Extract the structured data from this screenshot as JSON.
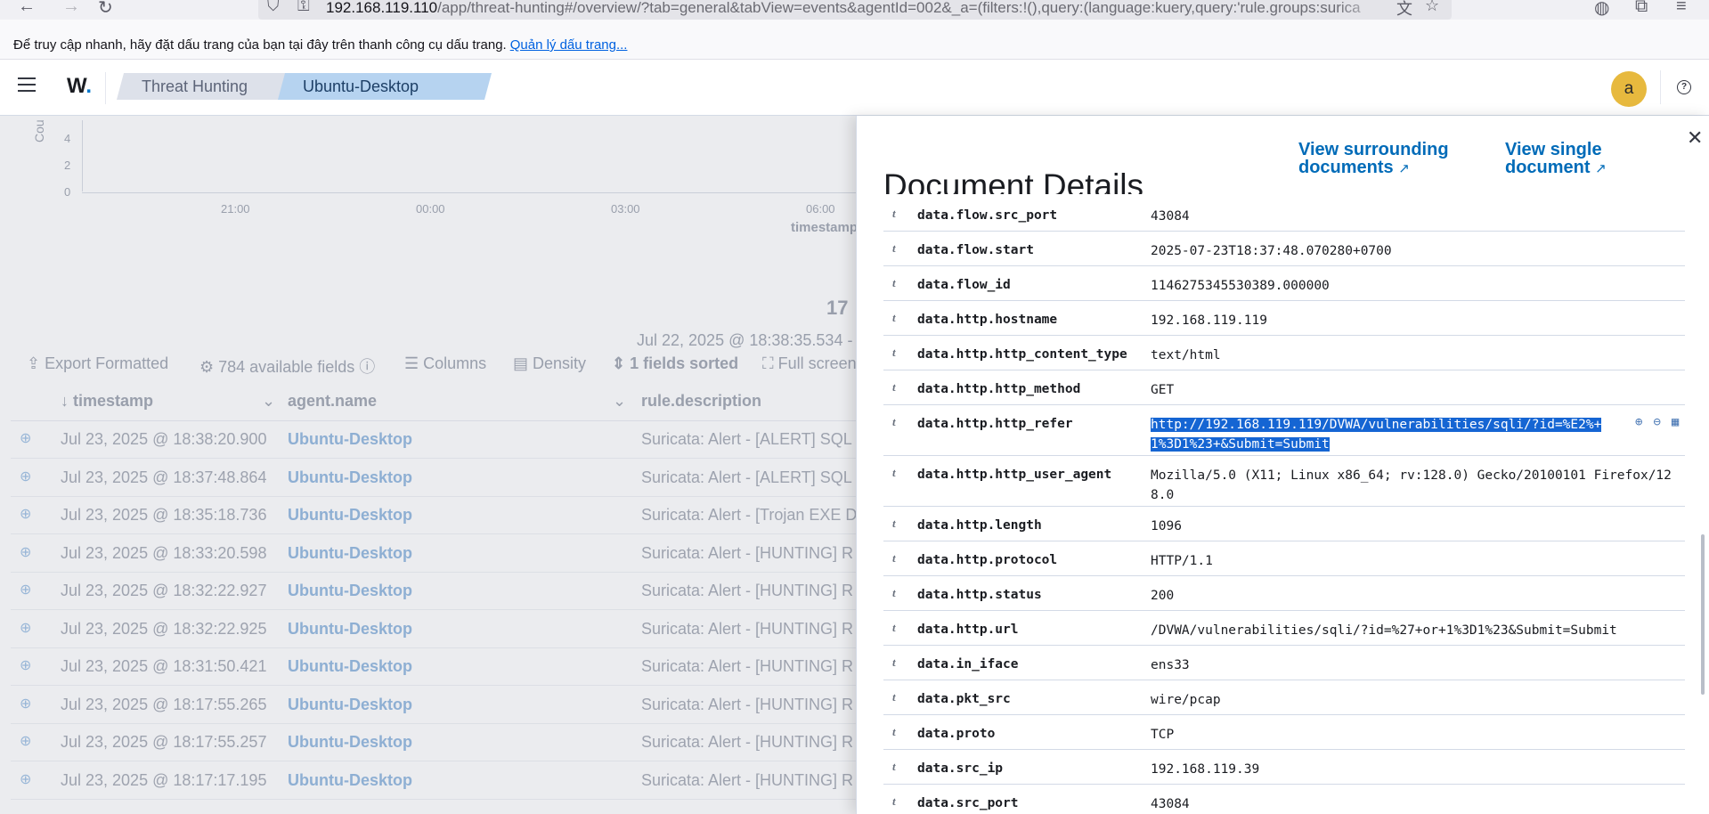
{
  "browser": {
    "url_host": "192.168.119.110",
    "url_rest": "/app/threat-hunting#/overview/?tab=general&tabView=events&agentId=002&_a=(filters:!(),query:(language:kuery,query:'rule.groups:surica",
    "bookmark_prompt": "Để truy cập nhanh, hãy đặt dấu trang của bạn tại đây trên thanh công cụ dấu trang.",
    "bookmark_manage": "Quản lý dấu trang..."
  },
  "header": {
    "logo": "W",
    "breadcrumbs": [
      "Threat Hunting",
      "Ubuntu-Desktop"
    ],
    "avatar": "a",
    "help": "?"
  },
  "chart": {
    "ylabel": "Cou",
    "yticks": [
      "4",
      "2",
      "0"
    ],
    "xticks": [
      "21:00",
      "00:00",
      "03:00",
      "06:00"
    ],
    "xlabel": "timestamp"
  },
  "events": {
    "hits": "17",
    "range": "Jul 22, 2025 @ 18:38:35.534 -",
    "toolbar": {
      "export": "Export Formatted",
      "fields": "784 available fields",
      "columns": "Columns",
      "density": "Density",
      "sorted": "1 fields sorted",
      "fullscreen": "Full screen"
    },
    "columns": [
      "timestamp",
      "agent.name",
      "rule.description"
    ],
    "rows": [
      {
        "ts": "Jul 23, 2025 @ 18:38:20.900",
        "agent": "Ubuntu-Desktop",
        "desc": "Suricata: Alert - [ALERT] SQL"
      },
      {
        "ts": "Jul 23, 2025 @ 18:37:48.864",
        "agent": "Ubuntu-Desktop",
        "desc": "Suricata: Alert - [ALERT] SQL"
      },
      {
        "ts": "Jul 23, 2025 @ 18:35:18.736",
        "agent": "Ubuntu-Desktop",
        "desc": "Suricata: Alert - [Trojan EXE D"
      },
      {
        "ts": "Jul 23, 2025 @ 18:33:20.598",
        "agent": "Ubuntu-Desktop",
        "desc": "Suricata: Alert - [HUNTING] R"
      },
      {
        "ts": "Jul 23, 2025 @ 18:32:22.927",
        "agent": "Ubuntu-Desktop",
        "desc": "Suricata: Alert - [HUNTING] R"
      },
      {
        "ts": "Jul 23, 2025 @ 18:32:22.925",
        "agent": "Ubuntu-Desktop",
        "desc": "Suricata: Alert - [HUNTING] R"
      },
      {
        "ts": "Jul 23, 2025 @ 18:31:50.421",
        "agent": "Ubuntu-Desktop",
        "desc": "Suricata: Alert - [HUNTING] R"
      },
      {
        "ts": "Jul 23, 2025 @ 18:17:55.265",
        "agent": "Ubuntu-Desktop",
        "desc": "Suricata: Alert - [HUNTING] R"
      },
      {
        "ts": "Jul 23, 2025 @ 18:17:55.257",
        "agent": "Ubuntu-Desktop",
        "desc": "Suricata: Alert - [HUNTING] R"
      },
      {
        "ts": "Jul 23, 2025 @ 18:17:17.195",
        "agent": "Ubuntu-Desktop",
        "desc": "Suricata: Alert - [HUNTING] R"
      }
    ]
  },
  "flyout": {
    "title": "Document Details",
    "link_surrounding": [
      "View surrounding",
      "documents"
    ],
    "link_single": [
      "View single",
      "document"
    ],
    "fields": [
      {
        "name": "data.flow.src_port",
        "value": "43084"
      },
      {
        "name": "data.flow.start",
        "value": "2025-07-23T18:37:48.070280+0700"
      },
      {
        "name": "data.flow_id",
        "value": "1146275345530389.000000"
      },
      {
        "name": "data.http.hostname",
        "value": "192.168.119.119"
      },
      {
        "name": "data.http.http_content_type",
        "value": "text/html"
      },
      {
        "name": "data.http.http_method",
        "value": "GET"
      },
      {
        "name": "data.http.http_refer",
        "value": "http://192.168.119.119/DVWA/vulnerabilities/sqli/?id=%E2%+1%3D1%23+&Submit=Submit",
        "selected": true
      },
      {
        "name": "data.http.http_user_agent",
        "value": "Mozilla/5.0 (X11; Linux x86_64; rv:128.0) Gecko/20100101 Firefox/128.0"
      },
      {
        "name": "data.http.length",
        "value": "1096"
      },
      {
        "name": "data.http.protocol",
        "value": "HTTP/1.1"
      },
      {
        "name": "data.http.status",
        "value": "200"
      },
      {
        "name": "data.http.url",
        "value": "/DVWA/vulnerabilities/sqli/?id=%27+or+1%3D1%23&Submit=Submit"
      },
      {
        "name": "data.in_iface",
        "value": "ens33"
      },
      {
        "name": "data.pkt_src",
        "value": "wire/pcap"
      },
      {
        "name": "data.proto",
        "value": "TCP"
      },
      {
        "name": "data.src_ip",
        "value": "192.168.119.39"
      },
      {
        "name": "data.src_port",
        "value": "43084"
      }
    ],
    "field_type": "t"
  }
}
